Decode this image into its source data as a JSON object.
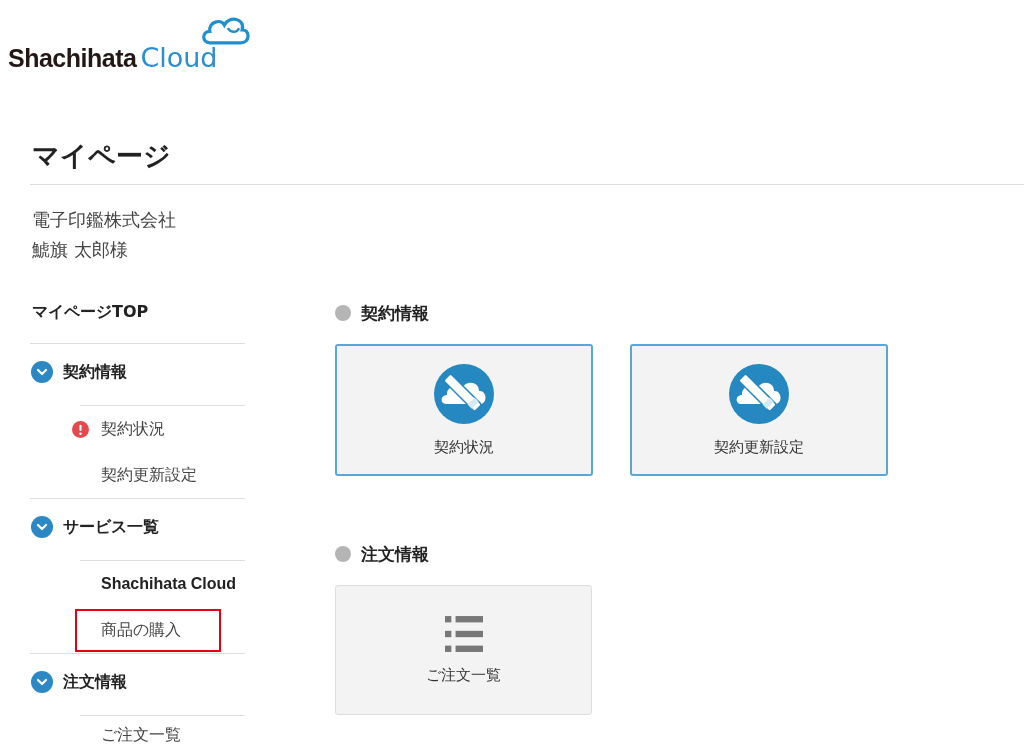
{
  "logo": {
    "brand": "Shachihata",
    "product": "Cloud"
  },
  "page_title": "マイページ",
  "user": {
    "company": "電子印鑑株式会社",
    "name": "鯱旗 太郎様"
  },
  "sidebar": {
    "top_link": "マイページTOP",
    "sections": [
      {
        "label": "契約情報",
        "expanded": true,
        "children": [
          {
            "label": "契約状況",
            "kind": "link",
            "alert": true,
            "highlighted": false
          },
          {
            "label": "契約更新設定",
            "kind": "link",
            "alert": false,
            "highlighted": false
          }
        ]
      },
      {
        "label": "サービス一覧",
        "expanded": true,
        "children": [
          {
            "label": "Shachihata Cloud",
            "kind": "heading",
            "alert": false,
            "highlighted": false
          },
          {
            "label": "商品の購入",
            "kind": "link",
            "alert": false,
            "highlighted": true
          }
        ]
      },
      {
        "label": "注文情報",
        "expanded": true,
        "children": [
          {
            "label": "ご注文一覧",
            "kind": "link",
            "alert": false,
            "highlighted": false
          }
        ]
      }
    ]
  },
  "main": {
    "sections": [
      {
        "heading": "契約情報",
        "cards": [
          {
            "label": "契約状況",
            "kind": "contract"
          },
          {
            "label": "契約更新設定",
            "kind": "contract"
          }
        ]
      },
      {
        "heading": "注文情報",
        "cards": [
          {
            "label": "ご注文一覧",
            "kind": "list"
          }
        ]
      }
    ]
  }
}
